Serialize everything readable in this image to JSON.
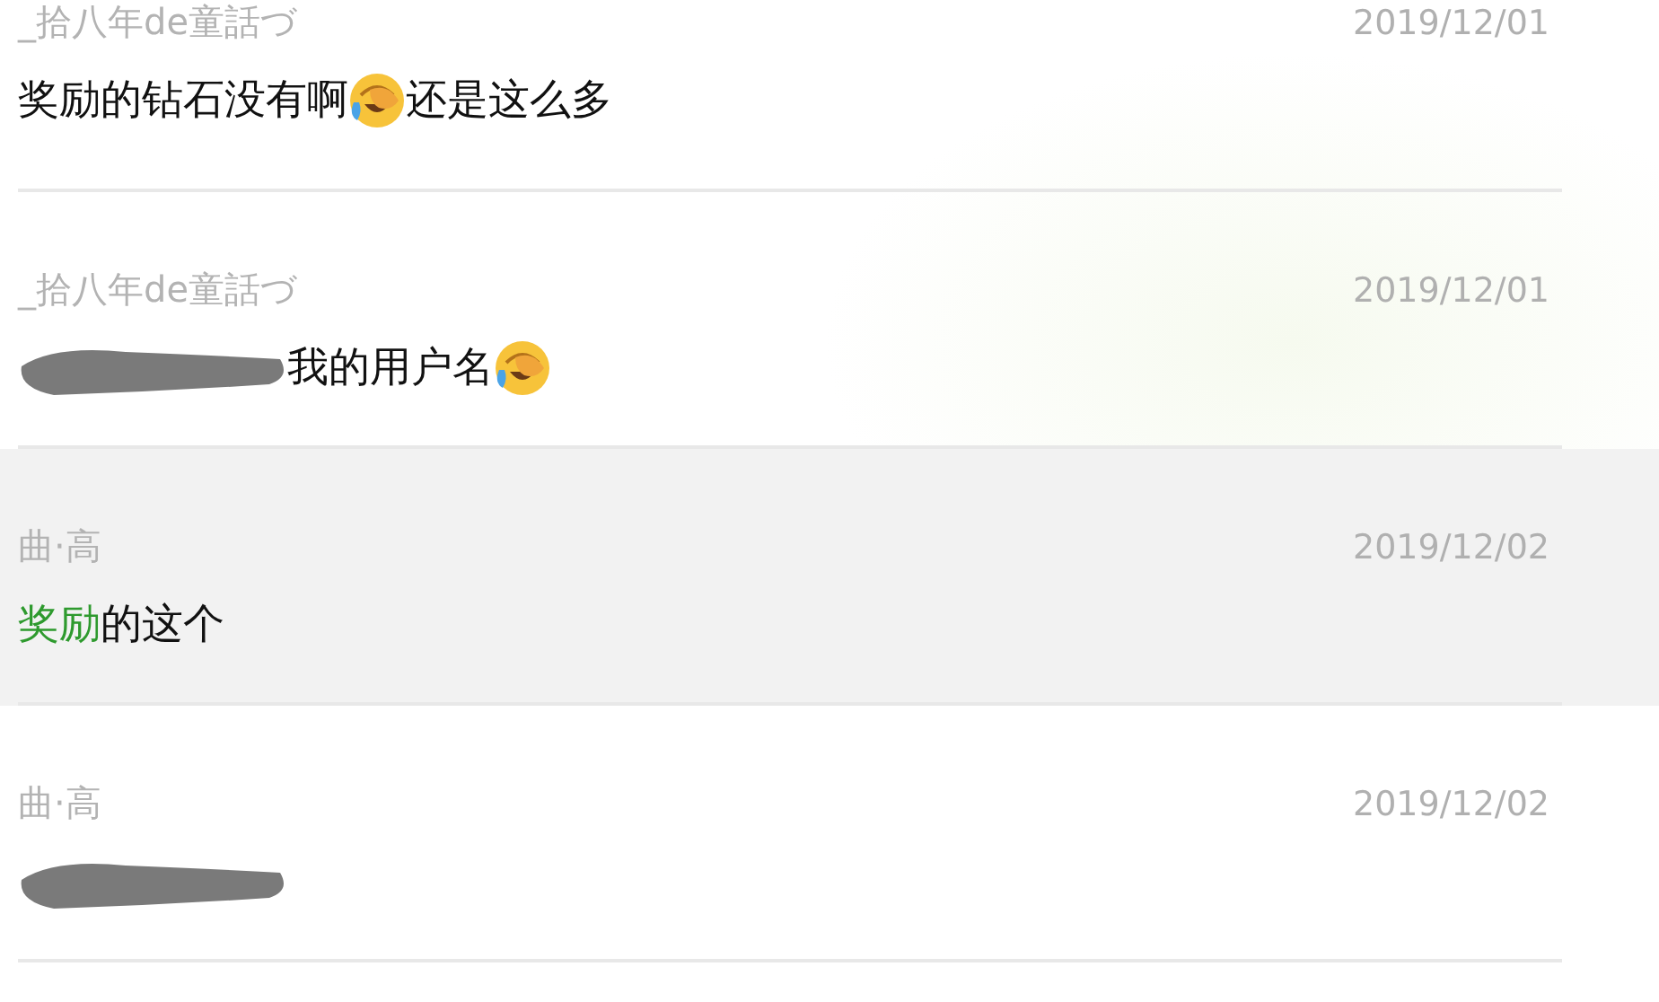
{
  "messages": [
    {
      "name": "_拾八年de童話づ",
      "date": "2019/12/01",
      "selected": false,
      "parts": [
        {
          "kind": "text",
          "text": "奖励的钻石没有啊",
          "highlight": false
        },
        {
          "kind": "emoji"
        },
        {
          "kind": "text",
          "text": "还是这么多",
          "highlight": false
        }
      ]
    },
    {
      "name": "_拾八年de童話づ",
      "date": "2019/12/01",
      "selected": false,
      "parts": [
        {
          "kind": "redacted"
        },
        {
          "kind": "text",
          "text": "我的用户名",
          "highlight": false
        },
        {
          "kind": "emoji"
        }
      ]
    },
    {
      "name": "曲·高",
      "date": "2019/12/02",
      "selected": true,
      "parts": [
        {
          "kind": "text",
          "text": "奖励",
          "highlight": true
        },
        {
          "kind": "text",
          "text": "的这个",
          "highlight": false
        }
      ]
    },
    {
      "name": "曲·高",
      "date": "2019/12/02",
      "selected": false,
      "parts": [
        {
          "kind": "redacted"
        }
      ]
    }
  ]
}
